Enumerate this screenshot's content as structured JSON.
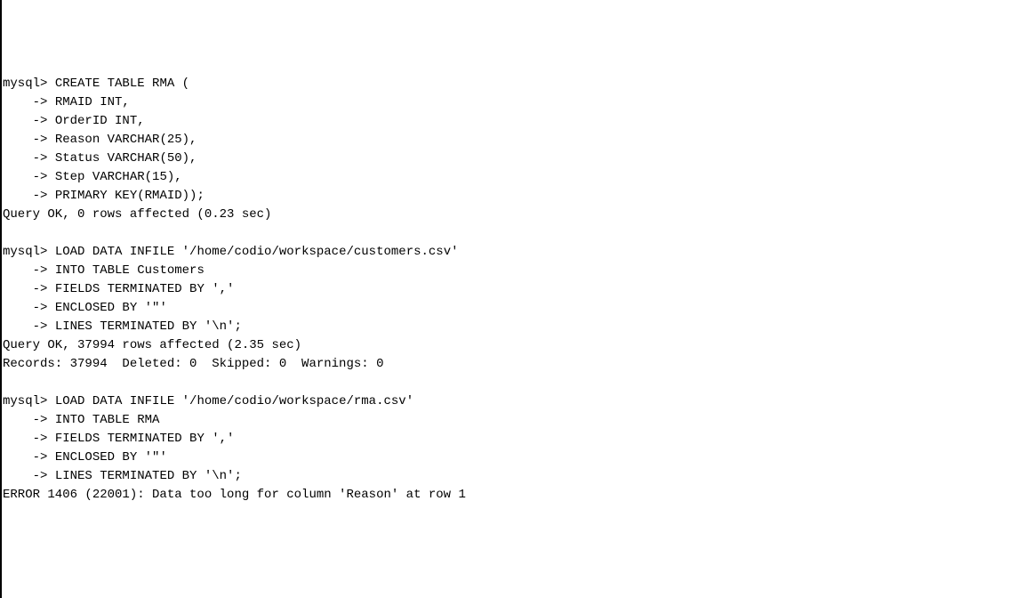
{
  "prompts": {
    "mysql": "mysql>",
    "cont": "    ->"
  },
  "block1": {
    "cmd0": " CREATE TABLE RMA (",
    "cmd1": " RMAID INT,",
    "cmd2": " OrderID INT,",
    "cmd3": " Reason VARCHAR(25),",
    "cmd4": " Status VARCHAR(50),",
    "cmd5": " Step VARCHAR(15),",
    "cmd6": " PRIMARY KEY(RMAID));",
    "result": "Query OK, 0 rows affected (0.23 sec)"
  },
  "block2": {
    "cmd0": " LOAD DATA INFILE '/home/codio/workspace/customers.csv'",
    "cmd1": " INTO TABLE Customers",
    "cmd2": " FIELDS TERMINATED BY ','",
    "cmd3": " ENCLOSED BY '\"'",
    "cmd4": " LINES TERMINATED BY '\\n';",
    "result1": "Query OK, 37994 rows affected (2.35 sec)",
    "result2": "Records: 37994  Deleted: 0  Skipped: 0  Warnings: 0"
  },
  "block3": {
    "cmd0": " LOAD DATA INFILE '/home/codio/workspace/rma.csv'",
    "cmd1": " INTO TABLE RMA",
    "cmd2": " FIELDS TERMINATED BY ','",
    "cmd3": " ENCLOSED BY '\"'",
    "cmd4": " LINES TERMINATED BY '\\n';",
    "error": "ERROR 1406 (22001): Data too long for column 'Reason' at row 1"
  }
}
